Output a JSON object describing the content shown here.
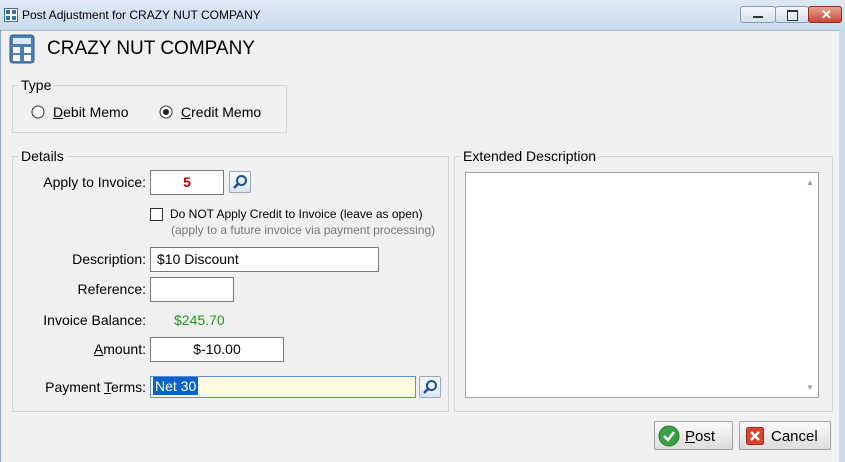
{
  "window": {
    "title": "Post Adjustment for CRAZY NUT COMPANY"
  },
  "header": {
    "company_name": "CRAZY NUT COMPANY"
  },
  "type_group": {
    "legend": "Type",
    "options": [
      {
        "label_first": "D",
        "label_rest": "ebit Memo",
        "selected": false
      },
      {
        "label_first": "C",
        "label_rest": "redit Memo",
        "selected": true
      }
    ]
  },
  "details": {
    "legend": "Details",
    "apply_to_invoice_label": "Apply to Invoice:",
    "apply_to_invoice_value": "5",
    "do_not_apply_label": "Do NOT Apply Credit to Invoice (leave as open)",
    "do_not_apply_hint": "(apply to a future invoice via payment processing)",
    "do_not_apply_checked": false,
    "description_label": "Description:",
    "description_value": "$10 Discount",
    "reference_label": "Reference:",
    "reference_value": "",
    "invoice_balance_label": "Invoice Balance:",
    "invoice_balance_value": "$245.70",
    "amount_label_first": "A",
    "amount_label_rest": "mount:",
    "amount_value": "$-10.00",
    "payment_terms_label_pre": "Payment ",
    "payment_terms_label_u": "T",
    "payment_terms_label_post": "erms:",
    "payment_terms_value": "Net 30"
  },
  "extended": {
    "legend": "Extended Description",
    "value": ""
  },
  "buttons": {
    "post_first": "P",
    "post_rest": "ost",
    "cancel": "Cancel"
  },
  "colors": {
    "balance": "#1a9a1a",
    "invoice_number": "#c00000",
    "selection": "#0a64c8"
  }
}
